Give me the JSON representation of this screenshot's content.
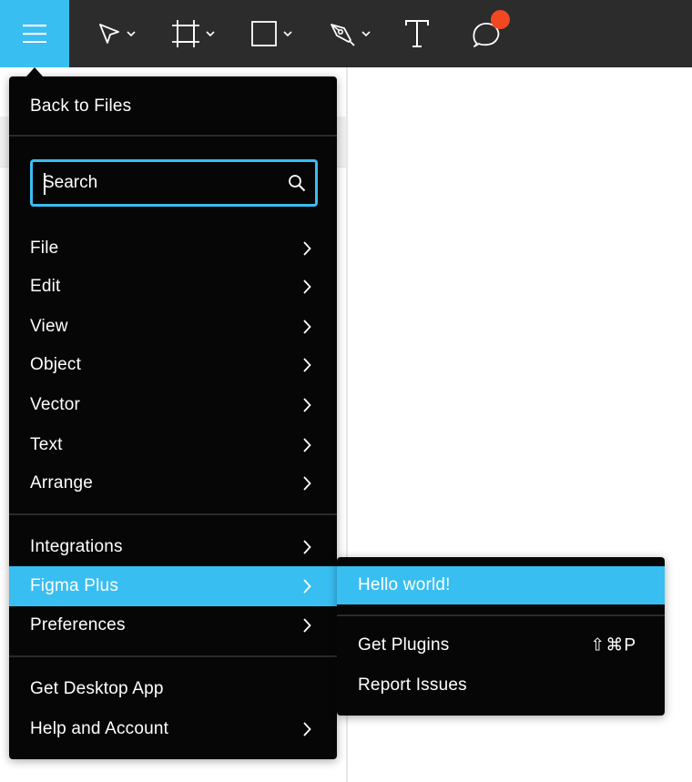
{
  "toolbar": {
    "menu_icon": "hamburger-icon",
    "tools": [
      {
        "name": "move-tool",
        "icon": "cursor-arrow-icon",
        "has_dropdown": true
      },
      {
        "name": "frame-tool",
        "icon": "frame-icon",
        "has_dropdown": true
      },
      {
        "name": "shape-tool",
        "icon": "rectangle-icon",
        "has_dropdown": true
      },
      {
        "name": "pen-tool",
        "icon": "pen-nib-icon",
        "has_dropdown": true
      },
      {
        "name": "text-tool",
        "icon": "text-T-icon",
        "has_dropdown": false
      },
      {
        "name": "comment-tool",
        "icon": "speech-bubble-icon",
        "has_dropdown": false,
        "notification": true
      }
    ]
  },
  "menu": {
    "back_label": "Back to Files",
    "search": {
      "placeholder": "Search",
      "value": ""
    },
    "groups": [
      {
        "items": [
          {
            "label": "File",
            "submenu": true
          },
          {
            "label": "Edit",
            "submenu": true
          },
          {
            "label": "View",
            "submenu": true
          },
          {
            "label": "Object",
            "submenu": true
          },
          {
            "label": "Vector",
            "submenu": true
          },
          {
            "label": "Text",
            "submenu": true
          },
          {
            "label": "Arrange",
            "submenu": true
          }
        ]
      },
      {
        "items": [
          {
            "label": "Integrations",
            "submenu": true
          },
          {
            "label": "Figma Plus",
            "submenu": true,
            "active": true
          },
          {
            "label": "Preferences",
            "submenu": true
          }
        ]
      },
      {
        "items": [
          {
            "label": "Get Desktop App",
            "submenu": false
          },
          {
            "label": "Help and Account",
            "submenu": true
          }
        ]
      }
    ]
  },
  "submenu": {
    "highlighted": "Hello world!",
    "items": [
      {
        "label": "Get Plugins",
        "shortcut": "⇧⌘P"
      },
      {
        "label": "Report Issues",
        "shortcut": ""
      }
    ]
  },
  "colors": {
    "accent": "#39bef2",
    "toolbar_bg": "#2c2c2c",
    "menu_bg": "#060606",
    "notification": "#f24822"
  }
}
